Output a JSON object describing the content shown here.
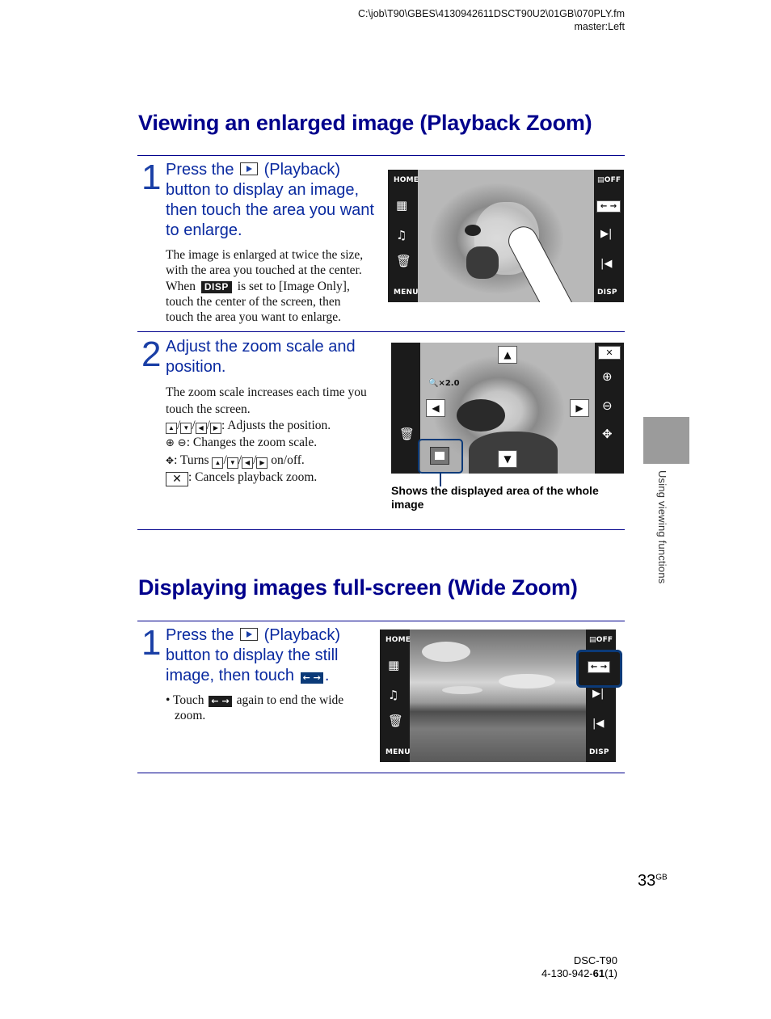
{
  "header": {
    "path": "C:\\job\\T90\\GBES\\4130942611DSCT90U2\\01GB\\070PLY.fm",
    "master": "master:Left"
  },
  "section1": {
    "title": "Viewing an enlarged image (Playback Zoom)",
    "step1": {
      "number": "1",
      "line1_pre": "Press the",
      "line1_post": "(Playback)",
      "lines": [
        "button to display an image,",
        "then touch the area you want",
        "to enlarge."
      ],
      "body1": "The image is enlarged at twice the size,",
      "body2": "with the area you touched at the center.",
      "body3_pre": "When",
      "disp_chip": "DISP",
      "body3_post": "is set to [Image Only],",
      "body4": "touch the center of the screen, then",
      "body5": "touch the area you want to enlarge.",
      "screen": {
        "left_buttons": [
          "HOME",
          "MENU"
        ],
        "right_top": "OFF",
        "right_bottom": "DISP",
        "wide_icon": "← →"
      }
    },
    "step2": {
      "number": "2",
      "lines": [
        "Adjust the zoom scale and",
        "position."
      ],
      "body1": "The zoom scale increases each time you",
      "body2": "touch the screen.",
      "position_desc": ": Adjusts the position.",
      "zoom_desc": ": Changes the zoom scale.",
      "toggle_desc_pre": ": Turns",
      "toggle_desc_post": "on/off.",
      "cancel_desc": ": Cancels playback zoom.",
      "screen": {
        "zoom_indicator": "×2.0",
        "close_label": "✕"
      },
      "caption": "Shows the displayed area of the whole image"
    }
  },
  "section2": {
    "title": "Displaying images full-screen (Wide Zoom)",
    "step1": {
      "number": "1",
      "line1_pre": "Press the",
      "line1_post": "(Playback)",
      "line2": "button to display the still",
      "line3_pre": "image, then touch",
      "line3_post": ".",
      "wide_chip": "← →",
      "bullet_pre": "• Touch",
      "bullet_post": "again to end the wide",
      "bullet_cont": "zoom.",
      "screen": {
        "left_buttons": [
          "HOME",
          "MENU"
        ],
        "right_top": "OFF",
        "right_bottom": "DISP"
      }
    }
  },
  "side_tab": {
    "label": "Using viewing functions",
    "color": "#9b9b9b"
  },
  "footer": {
    "page_number": "33",
    "page_suffix": "GB",
    "model": "DSC-T90",
    "part_pre": "4-130-942-",
    "part_bold": "61",
    "part_post": "(1)"
  },
  "colors": {
    "title_blue": "#00008c",
    "step_blue": "#0a2aa0",
    "highlight_blue": "#0b3a78"
  }
}
